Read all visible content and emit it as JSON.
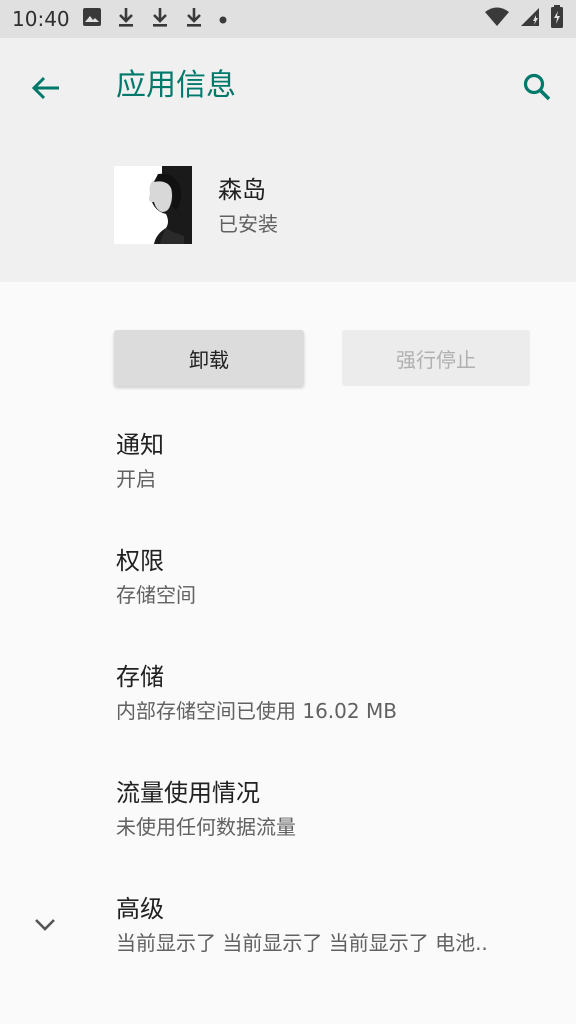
{
  "status_bar": {
    "time": "10:40",
    "left_icons": [
      "image-icon",
      "download-icon",
      "download-icon",
      "download-icon",
      "dot-icon"
    ],
    "right_icons": [
      "wifi-icon",
      "signal-icon",
      "battery-charging-icon"
    ]
  },
  "header": {
    "title": "应用信息",
    "accent_color": "#00796b"
  },
  "app": {
    "name": "森岛",
    "status": "已安装"
  },
  "buttons": {
    "uninstall": "卸载",
    "force_stop": "强行停止"
  },
  "items": [
    {
      "title": "通知",
      "subtitle": "开启"
    },
    {
      "title": "权限",
      "subtitle": "存储空间"
    },
    {
      "title": "存储",
      "subtitle": "内部存储空间已使用 16.02 MB"
    },
    {
      "title": "流量使用情况",
      "subtitle": "未使用任何数据流量"
    },
    {
      "title": "高级",
      "subtitle": "当前显示了 当前显示了 当前显示了 电池.."
    }
  ]
}
